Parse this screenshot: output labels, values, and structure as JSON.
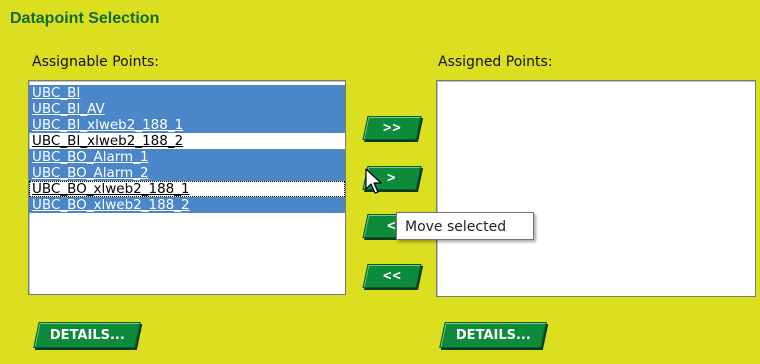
{
  "section": {
    "title": "Datapoint Selection"
  },
  "assignable": {
    "label": "Assignable Points:",
    "items": [
      {
        "text": "UBC_BI"
      },
      {
        "text": "UBC_BI_AV"
      },
      {
        "text": "UBC_BI_xlweb2_188_1"
      },
      {
        "text": "UBC_BI_xlweb2_188_2"
      },
      {
        "text": "UBC_BO_Alarm_1"
      },
      {
        "text": "UBC_BO_Alarm_2"
      },
      {
        "text": "UBC_BO_xlweb2_188_1"
      },
      {
        "text": "UBC_BO_xlweb2_188_2"
      }
    ],
    "details_label": "DETAILS..."
  },
  "assigned": {
    "label": "Assigned Points:",
    "items": [],
    "details_label": "DETAILS..."
  },
  "move_buttons": {
    "move_all_right": ">>",
    "move_right": ">",
    "move_left": "<",
    "move_all_left": "<<"
  },
  "tooltip": {
    "text": "Move selected"
  },
  "colors": {
    "background": "#dbdf1f",
    "title": "#0f6b2e",
    "button": "#0d8a3a",
    "selection": "#4a86c8"
  }
}
